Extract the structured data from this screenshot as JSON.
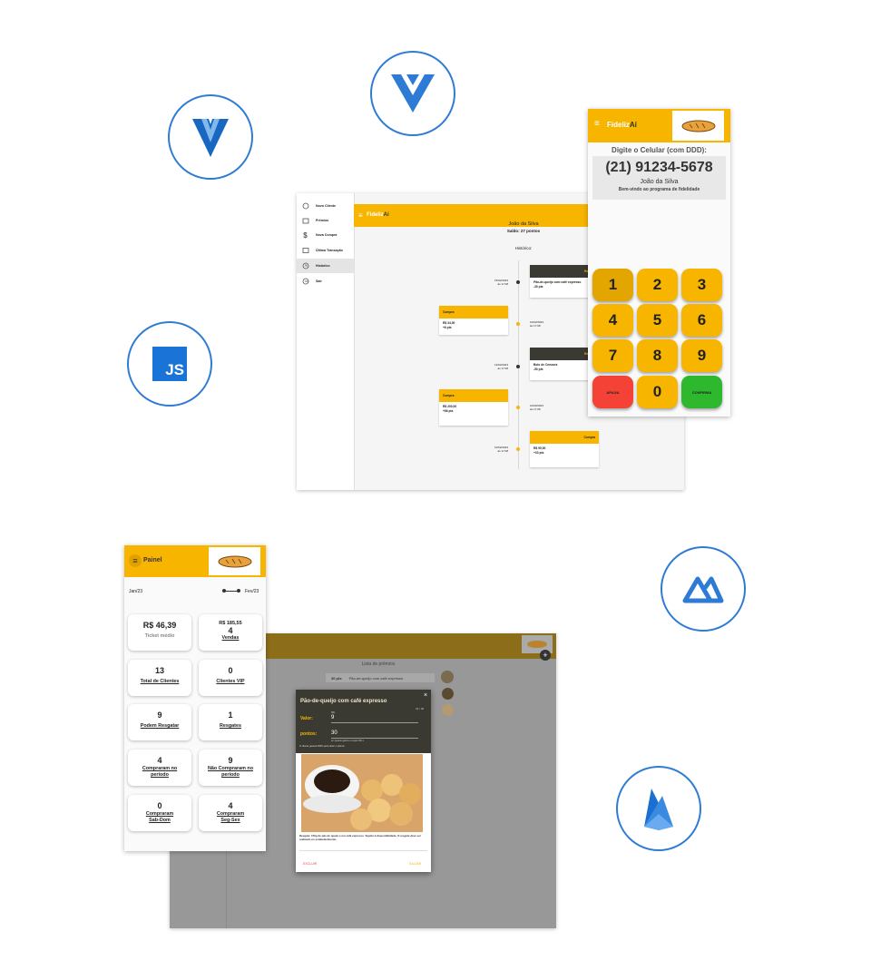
{
  "tech_icons": [
    {
      "name": "vuetify-icon"
    },
    {
      "name": "vue-icon"
    },
    {
      "name": "javascript-icon",
      "label": "JS"
    },
    {
      "name": "nuxt-icon"
    },
    {
      "name": "firebase-icon"
    }
  ],
  "history": {
    "brand_a": "Fideliz",
    "brand_b": "Aí",
    "sidebar": [
      {
        "label": "Novo Cliente"
      },
      {
        "label": "Prêmios"
      },
      {
        "label": "Nova Compra"
      },
      {
        "label": "Última Transação"
      },
      {
        "label": "Histórico"
      },
      {
        "label": "Sair"
      }
    ],
    "customer": "João da Silva",
    "balance": "Saldo: 27 pontos",
    "section": "Histórico:",
    "events": [
      {
        "date": "15/02/2023",
        "time": "às 17:08",
        "header": "Res",
        "line1": "Pão-de-queijo com café expresso",
        "line2": "-30 pts"
      },
      {
        "date": "10/02/2023",
        "time": "às 17:08",
        "header": "Compra",
        "line1": "R$ 34,00",
        "line2": "+6 pts"
      },
      {
        "date": "13/02/2023",
        "time": "às 17:08",
        "header": "Res",
        "line1": "Bolo de Cenoura",
        "line2": "-50 pts"
      },
      {
        "date": "10/02/2023",
        "time": "às 17:08",
        "header": "Compra",
        "line1": "R$ 200,00",
        "line2": "+66 pts"
      },
      {
        "date": "10/02/2023",
        "time": "às 17:08",
        "header": "Compra",
        "line1": "R$ 95,00",
        "line2": "+33 pts"
      }
    ]
  },
  "keypad": {
    "brand_a": "Fideliz",
    "brand_b": "Aí",
    "prompt": "Digite o Celular (com DDD):",
    "phone": "(21) 91234-5678",
    "name": "João da Silva",
    "welcome": "Bem-vindo ao programa de fidelidade",
    "keys": [
      "1",
      "2",
      "3",
      "4",
      "5",
      "6",
      "7",
      "8",
      "9",
      "APAGA",
      "0",
      "CONFIRMA"
    ]
  },
  "dashboard": {
    "title": "Painel",
    "range_start": "Jan/23",
    "range_end": "Fev/23",
    "cards": [
      {
        "value": "R$ 46,39",
        "label": "Ticket médio",
        "link": false
      },
      {
        "value": "R$ 185,55",
        "value2": "4",
        "label": "Vendas",
        "link": true
      },
      {
        "value": "13",
        "label": "Total de Clientes",
        "link": true
      },
      {
        "value": "0",
        "label": "Clientes VIP",
        "link": true
      },
      {
        "value": "9",
        "label": "Podem Resgatar",
        "link": true
      },
      {
        "value": "1",
        "label": "Resgates",
        "link": true
      },
      {
        "value": "4",
        "label": "Compraram no período",
        "link": true
      },
      {
        "value": "9",
        "label": "Não Compraram no período",
        "link": true
      },
      {
        "value": "0",
        "label": "Compraram Sab-Dom",
        "link": true
      },
      {
        "value": "4",
        "label": "Compraram Seg-Sex",
        "link": true
      }
    ]
  },
  "prizes": {
    "list_title": "Lista de prêmios",
    "row_points": "30 pts",
    "row_name": "Pão-de-queijo com café expresso",
    "dialog": {
      "title": "Pão-de-queijo com café expresso",
      "close": "×",
      "counter": "31 / 30",
      "value_label": "Valor:",
      "value_caption": "R$",
      "value": "9",
      "points_label": "pontos:",
      "points": "30",
      "points_hint": "em quanto ganha o cupom R$ 1",
      "note": "O cliente ganará 300% para obter 1 prêmio",
      "description": "Resgate: 150g de pão de queijo e um café expresso. Sujeito à disponibilidade. O resgate deve ser realizado no estabelecimento.",
      "delete": "EXCLUIR",
      "save": "SALVAR"
    }
  },
  "colors": {
    "accent": "#f7b500",
    "blue": "#2e7bd6",
    "red": "#f44336",
    "green": "#2eb82e",
    "dark": "#3a3a33"
  }
}
